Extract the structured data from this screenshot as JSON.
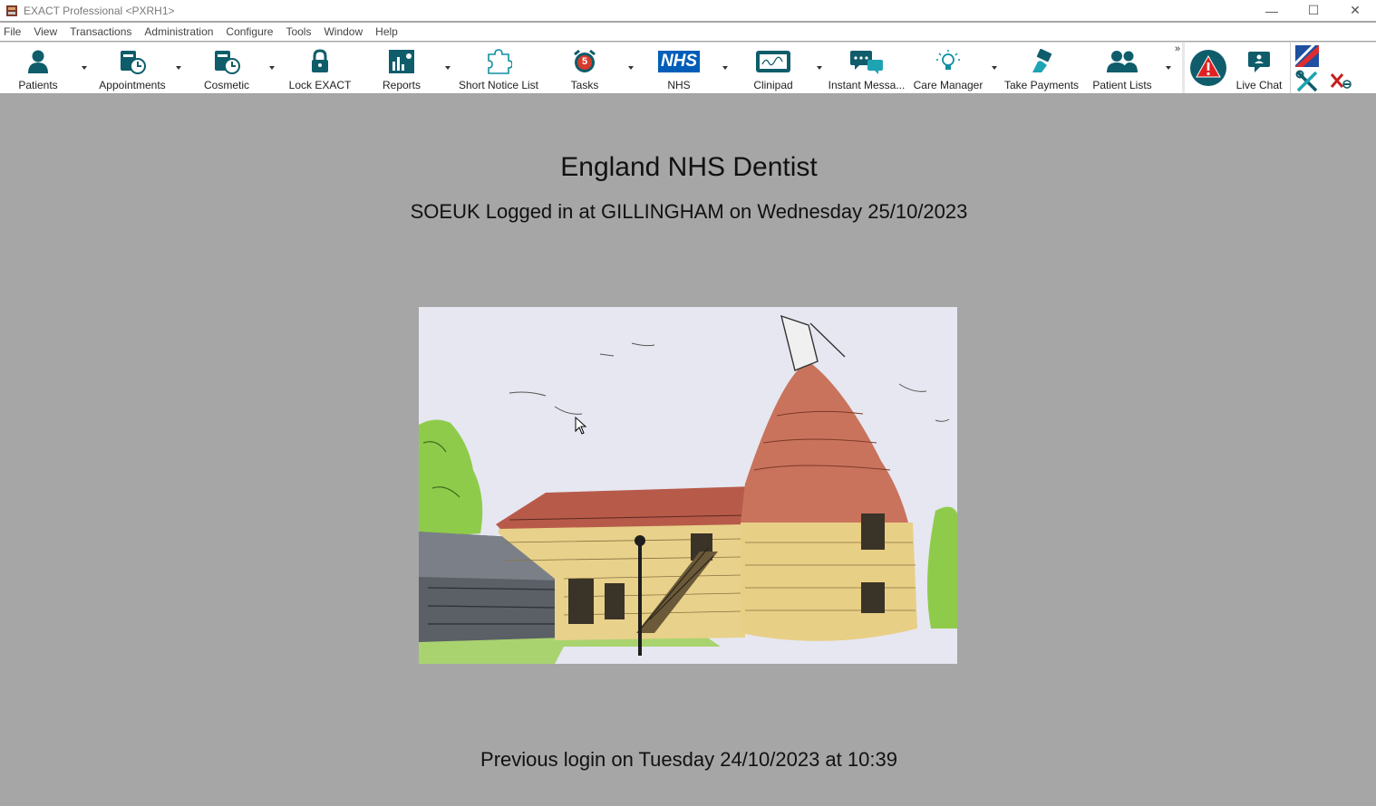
{
  "window": {
    "title": "EXACT Professional <PXRH1>",
    "minimize": "—",
    "maximize": "☐",
    "close": "✕"
  },
  "menu": [
    "File",
    "View",
    "Transactions",
    "Administration",
    "Configure",
    "Tools",
    "Window",
    "Help"
  ],
  "toolbar": {
    "patients": "Patients",
    "appointments": "Appointments",
    "cosmetic": "Cosmetic",
    "lock": "Lock EXACT",
    "reports": "Reports",
    "short_notice": "Short Notice List",
    "tasks": "Tasks",
    "tasks_badge": "5",
    "nhs": "NHS",
    "nhs_logo": "NHS",
    "clinipad": "Clinipad",
    "instant_messages": "Instant Messa...",
    "care_manager": "Care Manager",
    "take_payments": "Take Payments",
    "patient_lists": "Patient Lists",
    "overflow": "»",
    "live_chat": "Live Chat"
  },
  "main": {
    "practice_name": "England NHS Dentist",
    "login_line": "SOEUK Logged in at GILLINGHAM on Wednesday 25/10/2023",
    "previous_login": "Previous login on Tuesday 24/10/2023 at 10:39"
  },
  "colors": {
    "brand_teal": "#0f5d6b",
    "nhs_blue": "#005eb8",
    "alert_red": "#e02020",
    "background": "#a6a6a6"
  }
}
